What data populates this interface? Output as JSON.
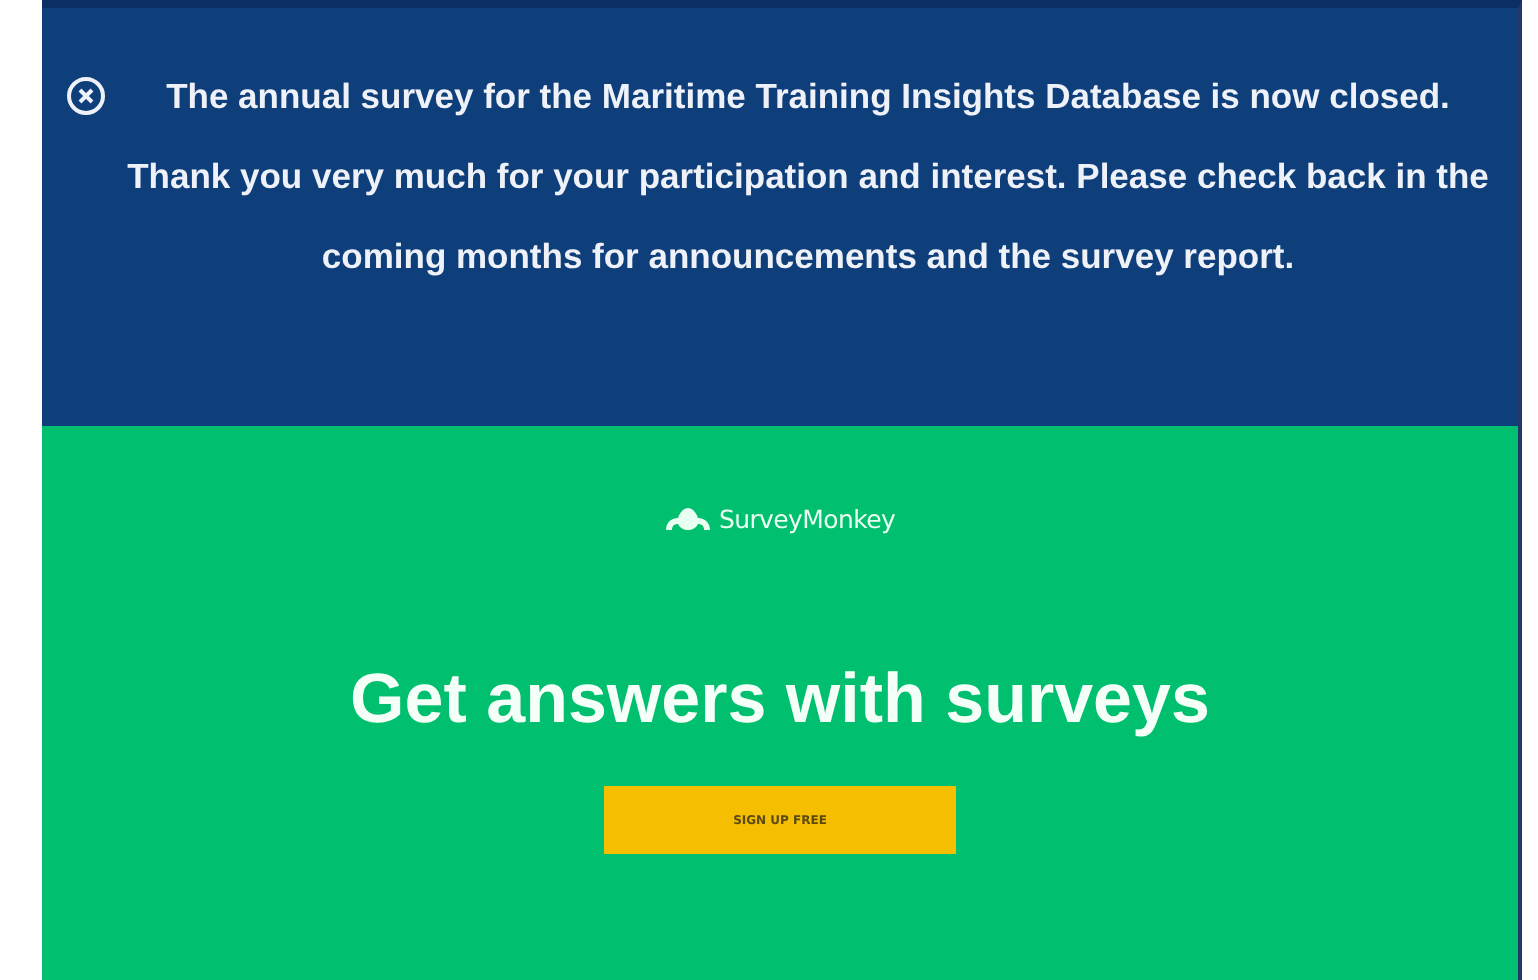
{
  "notice": {
    "dismissible": true,
    "text": "The annual survey for the Maritime Training Insights Database is now closed. Thank you very much for your participation and interest. Please check back in the coming months for announcements and the survey report."
  },
  "promo": {
    "logo_text": "SurveyMonkey",
    "headline": "Get answers with surveys",
    "button": "SIGN UP FREE"
  }
}
